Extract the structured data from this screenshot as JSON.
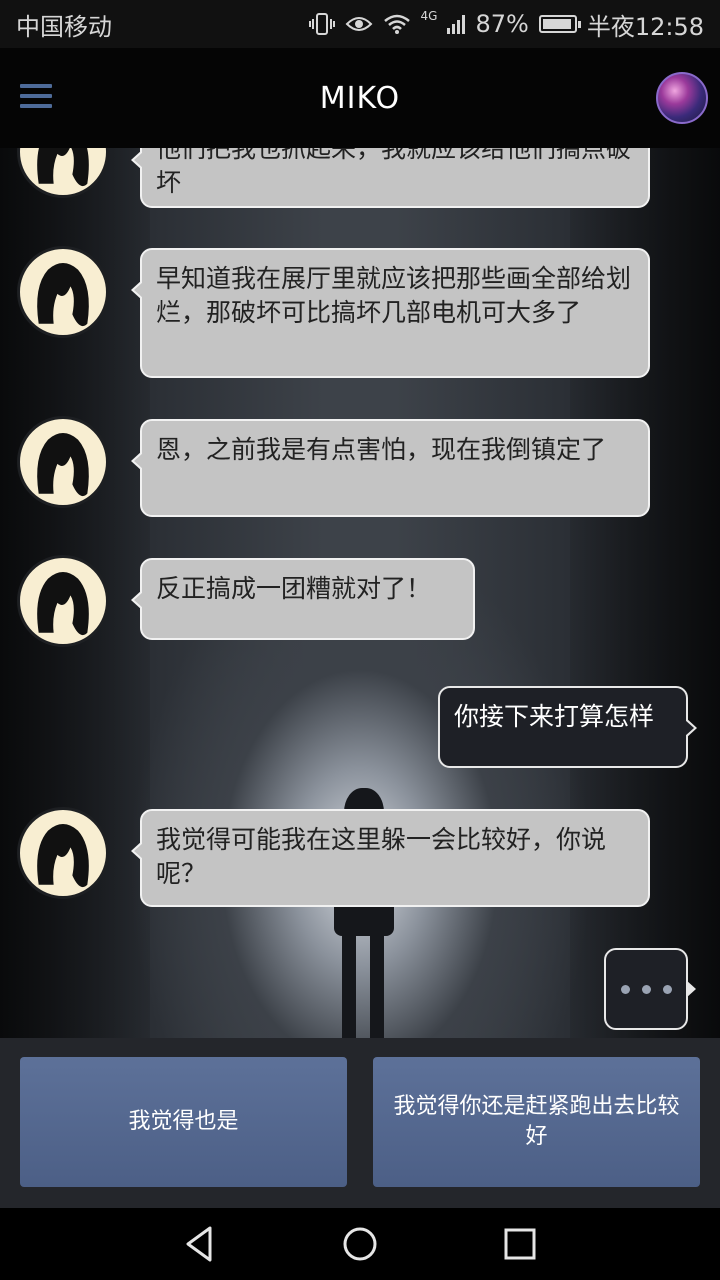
{
  "status_bar": {
    "carrier": "中国移动",
    "network": "4G",
    "battery_percent": "87%",
    "time": "半夜12:58",
    "battery_level": 0.87
  },
  "app_bar": {
    "title": "MIKO"
  },
  "messages": [
    {
      "sender": "miko",
      "text": "他们把我也抓起来，我就应该给他们搞点破坏"
    },
    {
      "sender": "miko",
      "text": "早知道我在展厅里就应该把那些画全部给划烂，那破坏可比搞坏几部电机可大多了"
    },
    {
      "sender": "miko",
      "text": "恩，之前我是有点害怕，现在我倒镇定了"
    },
    {
      "sender": "miko",
      "text": "反正搞成一团糟就对了！"
    },
    {
      "sender": "user",
      "text": "你接下来打算怎样"
    },
    {
      "sender": "miko",
      "text": "我觉得可能我在这里躲一会比较好，你说呢？"
    }
  ],
  "choices": [
    {
      "label": "我觉得也是"
    },
    {
      "label": "我觉得你还是赶紧跑出去比较好"
    }
  ],
  "colors": {
    "accent": "#4e6b99",
    "choice_button": "#55698f",
    "bubble_other": "#c4c4c4",
    "bubble_self": "#1e2026"
  },
  "icons": {
    "menu": "hamburger-icon",
    "typing": "ellipsis-icon",
    "back": "back-triangle-icon",
    "home": "home-circle-icon",
    "recent": "recent-square-icon"
  }
}
